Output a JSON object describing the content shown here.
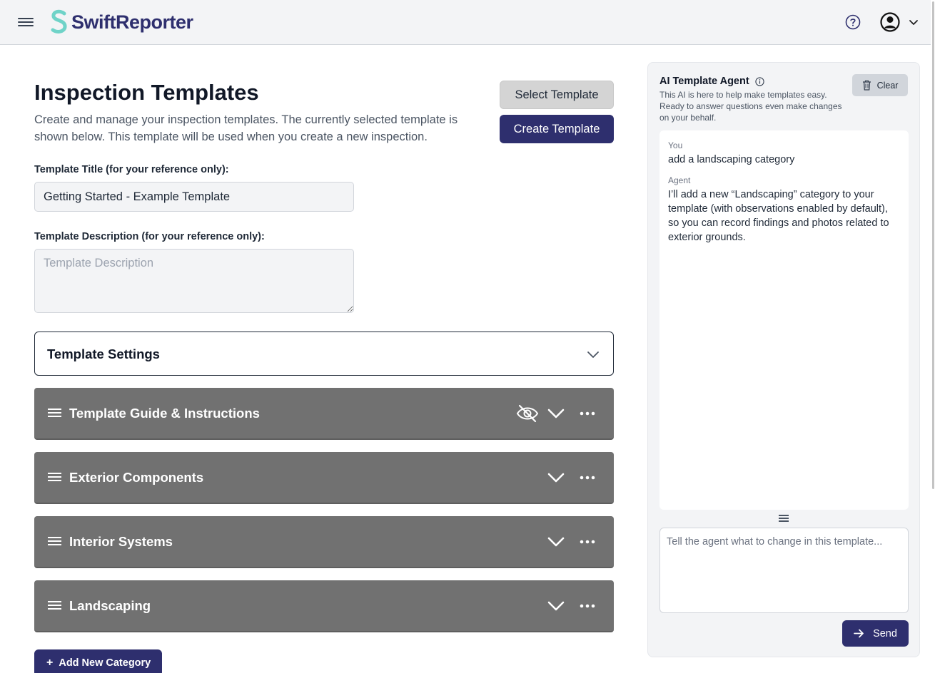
{
  "app": {
    "brand": "SwiftReporter",
    "brand_color": "#2e2f6e",
    "logo_color": "#6fd3c8"
  },
  "header": {
    "icons": [
      "menu-icon",
      "help-icon",
      "user-account-icon",
      "chevron-down-icon"
    ]
  },
  "main": {
    "title": "Inspection Templates",
    "description": "Create and manage your inspection templates. The currently selected template is shown below. This template will be used when you create a new inspection.",
    "select_template_label": "Select Template",
    "create_template_label": "Create Template",
    "title_field": {
      "label": "Template Title (for your reference only):",
      "value": "Getting Started - Example Template"
    },
    "description_field": {
      "label": "Template Description (for your reference only):",
      "value": "",
      "placeholder": "Template Description"
    },
    "settings": {
      "title": "Template Settings"
    },
    "categories": [
      {
        "title": "Template Guide & Instructions",
        "hidden": true
      },
      {
        "title": "Exterior Components",
        "hidden": false
      },
      {
        "title": "Interior Systems",
        "hidden": false
      },
      {
        "title": "Landscaping",
        "hidden": false
      }
    ],
    "add_category_label": "Add New Category"
  },
  "ai_panel": {
    "title": "AI Template Agent",
    "subtitle": "This AI is here to help make templates easy. Ready to answer questions even make changes on your behalf.",
    "clear_label": "Clear",
    "messages": [
      {
        "role": "You",
        "text": "add a landscaping category"
      },
      {
        "role": "Agent",
        "text": "I’ll add a new “Landscaping” category to your template (with observations enabled by default), so you can record findings and photos related to exterior grounds."
      }
    ],
    "input_placeholder": "Tell the agent what to change in this template...",
    "send_label": "Send"
  }
}
